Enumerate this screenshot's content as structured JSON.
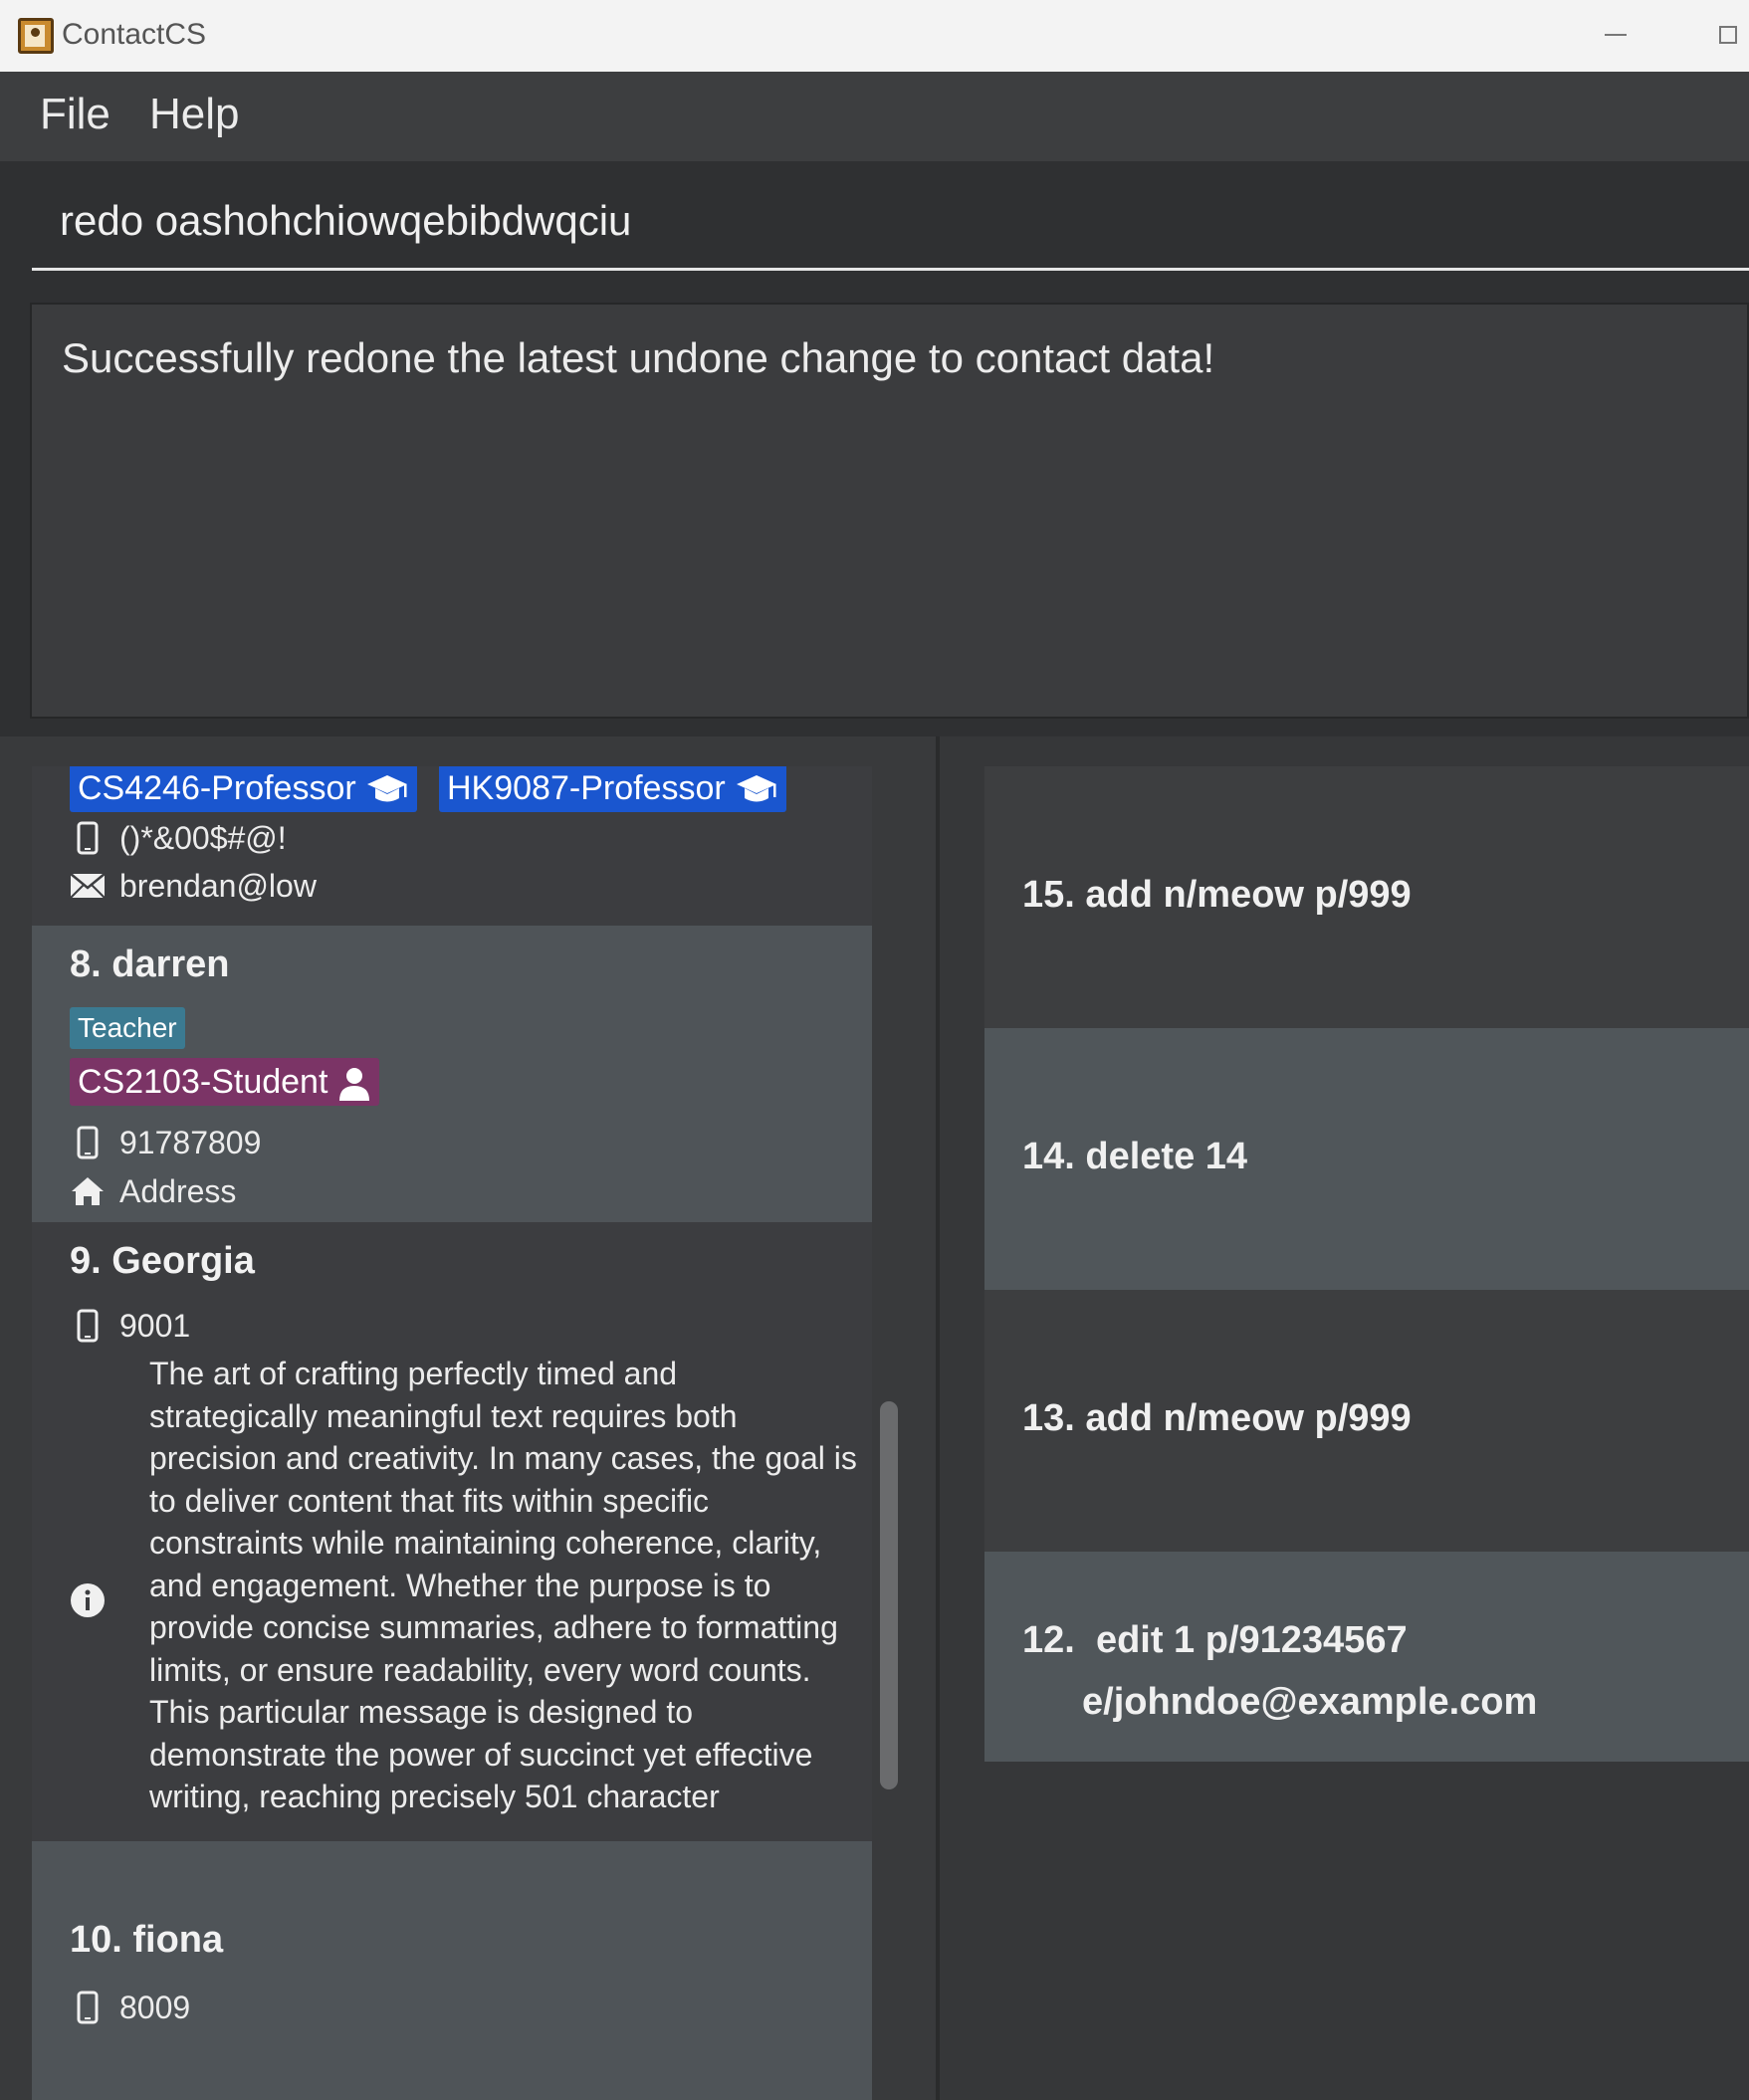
{
  "window": {
    "title": "ContactCS"
  },
  "menu": {
    "file": "File",
    "help": "Help"
  },
  "command": {
    "value": "redo oashohchiowqebibdwqciu"
  },
  "result": {
    "text": "Successfully redone the latest undone change to contact data!"
  },
  "persons": {
    "c7": {
      "tags": [
        "CS4246-Professor",
        "HK9087-Professor"
      ],
      "phone": "()*&00$#@!",
      "email": "brendan@low"
    },
    "c8": {
      "name": "8. darren",
      "role_tag": "Teacher",
      "course_tag": "CS2103-Student",
      "phone": "91787809",
      "address": "Address"
    },
    "c9": {
      "name": "9. Georgia",
      "phone": "9001",
      "remark_lines": [
        "The art of crafting perfectly timed and",
        "strategically meaningful text requires both",
        "precision and creativity. In many cases, the goal is",
        "to deliver content that fits within specific",
        "constraints while maintaining coherence, clarity,",
        "and engagement. Whether the purpose is to",
        "provide concise summaries, adhere to formatting",
        "limits, or ensure readability, every word counts.",
        "This particular message is designed to",
        "demonstrate the power of succinct yet effective",
        "writing, reaching precisely 501 character"
      ]
    },
    "c10": {
      "name": "10. fiona",
      "phone": "8009"
    }
  },
  "history": [
    {
      "text": "15. add n/meow p/999"
    },
    {
      "text": "14. delete 14"
    },
    {
      "text": "13. add n/meow p/999"
    },
    {
      "line1": "12.  edit 1 p/91234567",
      "line2": "e/johndoe@example.com"
    }
  ],
  "icons": {
    "app": "contact-book-icon",
    "phone": "phone-icon",
    "email": "mail-icon",
    "address": "home-icon",
    "remark": "info-icon",
    "professor": "graduation-cap-icon",
    "student": "person-icon"
  },
  "colors": {
    "tag_professor": "#1a56cf",
    "tag_student": "#7b3466",
    "tag_role": "#3b7a91"
  }
}
